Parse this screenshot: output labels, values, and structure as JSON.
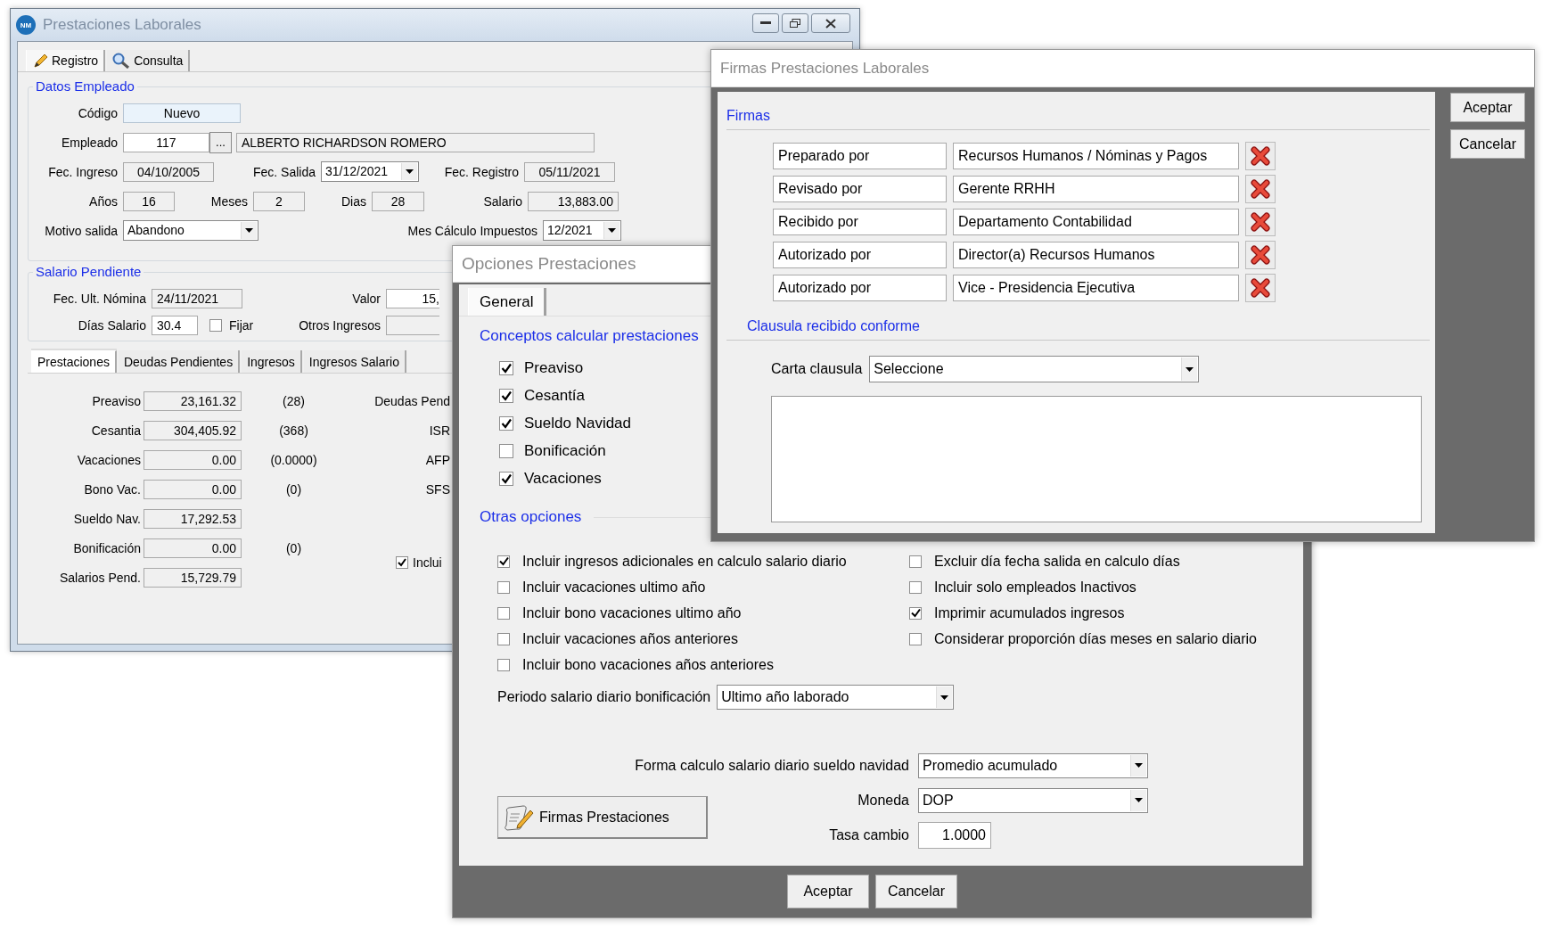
{
  "main_window": {
    "logo_text": "NM",
    "title": "Prestaciones Laborales",
    "tabs": [
      {
        "label": "Registro",
        "selected": true
      },
      {
        "label": "Consulta",
        "selected": false
      }
    ],
    "datos_empleado": {
      "title": "Datos Empleado",
      "codigo": {
        "label": "Código",
        "value": "Nuevo"
      },
      "empleado": {
        "label": "Empleado",
        "id": "117",
        "lookup": "...",
        "name": "ALBERTO RICHARDSON ROMERO"
      },
      "fec_ingreso": {
        "label": "Fec. Ingreso",
        "value": "04/10/2005"
      },
      "fec_salida": {
        "label": "Fec. Salida",
        "value": "31/12/2021"
      },
      "fec_registro": {
        "label": "Fec. Registro",
        "value": "05/11/2021"
      },
      "anos": {
        "label": "Años",
        "value": "16"
      },
      "meses": {
        "label": "Meses",
        "value": "2"
      },
      "dias": {
        "label": "Dias",
        "value": "28"
      },
      "salario": {
        "label": "Salario",
        "value": "13,883.00"
      },
      "motivo_salida": {
        "label": "Motivo salida",
        "value": "Abandono"
      },
      "mes_calculo_impuestos": {
        "label": "Mes Cálculo Impuestos",
        "value": "12/2021"
      }
    },
    "salario_pendiente": {
      "title": "Salario Pendiente",
      "fec_ult_nomina": {
        "label": "Fec. Ult. Nómina",
        "value": "24/11/2021"
      },
      "valor": {
        "label": "Valor",
        "value": "15,"
      },
      "dias_salario": {
        "label": "Días Salario",
        "value": "30.4"
      },
      "fijar": {
        "label": "Fijar",
        "checked": false
      },
      "otros_ingresos": {
        "label": "Otros Ingresos"
      }
    },
    "sub_tabs": [
      {
        "label": "Prestaciones",
        "selected": true
      },
      {
        "label": "Deudas Pendientes",
        "selected": false
      },
      {
        "label": "Ingresos",
        "selected": false
      },
      {
        "label": "Ingresos Salario",
        "selected": false
      }
    ],
    "prestaciones": [
      {
        "label": "Preaviso",
        "value": "23,161.32",
        "note": "(28)"
      },
      {
        "label": "Cesantia",
        "value": "304,405.92",
        "note": "(368)"
      },
      {
        "label": "Vacaciones",
        "value": "0.00",
        "note": "(0.0000)"
      },
      {
        "label": "Bono Vac.",
        "value": "0.00",
        "note": "(0)"
      },
      {
        "label": "Sueldo Nav.",
        "value": "17,292.53"
      },
      {
        "label": "Bonificación",
        "value": "0.00",
        "note": "(0)"
      },
      {
        "label": "Salarios Pend.",
        "value": "15,729.79"
      }
    ],
    "deducciones": [
      {
        "label": "Deudas Pend"
      },
      {
        "label": "ISR"
      },
      {
        "label": "AFP"
      },
      {
        "label": "SFS"
      }
    ],
    "incluir": {
      "label": "Inclui",
      "checked": true
    }
  },
  "options_window": {
    "title": "Opciones Prestaciones",
    "tabs": [
      {
        "label": "General",
        "selected": true
      }
    ],
    "conceptos": {
      "title": "Conceptos calcular prestaciones",
      "items": [
        {
          "label": "Preaviso",
          "checked": true
        },
        {
          "label": "Cesantía",
          "checked": true
        },
        {
          "label": "Sueldo Navidad",
          "checked": true
        },
        {
          "label": "Bonificación",
          "checked": false
        },
        {
          "label": "Vacaciones",
          "checked": true
        }
      ]
    },
    "otras": {
      "title": "Otras opciones",
      "left": [
        {
          "label": "Incluir ingresos adicionales en calculo salario diario",
          "checked": true
        },
        {
          "label": "Incluir vacaciones ultimo año",
          "checked": false
        },
        {
          "label": "Incluir bono vacaciones ultimo año",
          "checked": false
        },
        {
          "label": "Incluir vacaciones años anteriores",
          "checked": false
        },
        {
          "label": "Incluir bono vacaciones años anteriores",
          "checked": false
        }
      ],
      "right": [
        {
          "label": "Excluir día fecha salida en calculo días",
          "checked": false
        },
        {
          "label": "Incluir solo empleados Inactivos",
          "checked": false
        },
        {
          "label": "Imprimir acumulados ingresos",
          "checked": true
        },
        {
          "label": "Considerar proporción días meses en salario diario",
          "checked": false
        }
      ]
    },
    "periodo": {
      "label": "Periodo salario diario bonificación",
      "value": "Ultimo año laborado"
    },
    "forma": {
      "label": "Forma calculo salario diario sueldo navidad",
      "value": "Promedio acumulado"
    },
    "moneda": {
      "label": "Moneda",
      "value": "DOP"
    },
    "tasa": {
      "label": "Tasa cambio",
      "value": "1.0000"
    },
    "firmas_button": "Firmas Prestaciones",
    "buttons": [
      "Aceptar",
      "Cancelar"
    ]
  },
  "firmas_window": {
    "title": "Firmas Prestaciones Laborales",
    "section": "Firmas",
    "rows": [
      {
        "role": "Preparado por",
        "name": "Recursos Humanos / Nóminas y Pagos"
      },
      {
        "role": "Revisado por",
        "name": "Gerente RRHH"
      },
      {
        "role": "Recibido por",
        "name": "Departamento Contabilidad"
      },
      {
        "role": "Autorizado por",
        "name": "Director(a) Recursos Humanos"
      },
      {
        "role": "Autorizado por",
        "name": "Vice - Presidencia Ejecutiva"
      }
    ],
    "clausula": {
      "title": "Clausula recibido conforme",
      "label": "Carta clausula",
      "value": "Seleccione"
    },
    "buttons": [
      "Aceptar",
      "Cancelar"
    ]
  }
}
